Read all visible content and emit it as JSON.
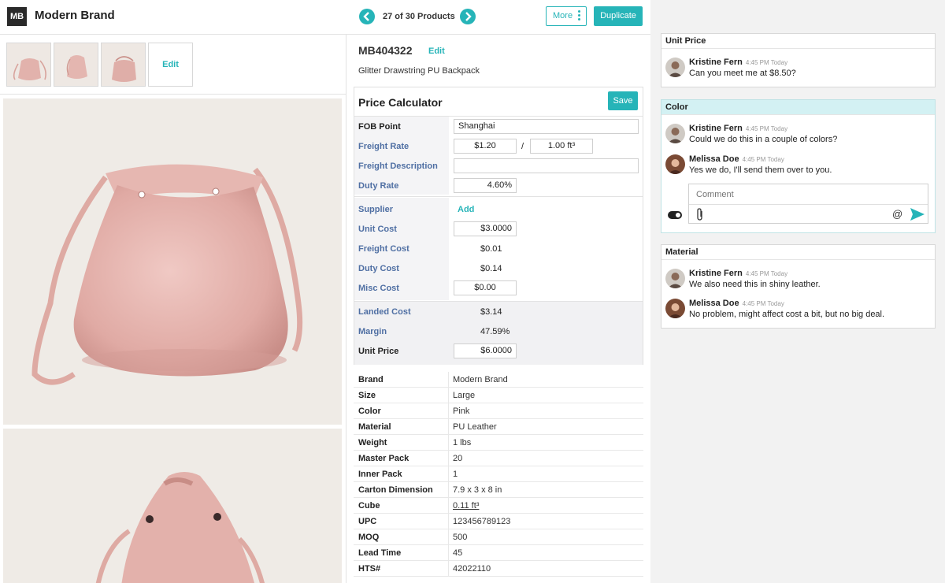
{
  "header": {
    "logo_initials": "MB",
    "brand": "Modern Brand",
    "product_counter": "27 of 30 Products",
    "prev_icon": "chevron-left-icon",
    "next_icon": "chevron-right-icon",
    "more_label": "More",
    "duplicate_label": "Duplicate",
    "accent_color": "#26b4b8"
  },
  "gallery": {
    "edit_label": "Edit",
    "thumbnail_count": 3
  },
  "product": {
    "sku": "MB404322",
    "sku_edit": "Edit",
    "name": "Glitter Drawstring PU Backpack"
  },
  "calculator": {
    "title": "Price Calculator",
    "save_label": "Save",
    "fob_point": {
      "label": "FOB Point",
      "value": "Shanghai"
    },
    "freight_rate": {
      "label": "Freight Rate",
      "value": "$1.20",
      "separator": "/",
      "unit": "1.00 ft³"
    },
    "freight_description": {
      "label": "Freight Description",
      "value": ""
    },
    "duty_rate": {
      "label": "Duty Rate",
      "value": "4.60%"
    },
    "supplier": {
      "label": "Supplier",
      "action": "Add"
    },
    "unit_cost": {
      "label": "Unit Cost",
      "value": "$3.0000"
    },
    "freight_cost": {
      "label": "Freight Cost",
      "value": "$0.01"
    },
    "duty_cost": {
      "label": "Duty Cost",
      "value": "$0.14"
    },
    "misc_cost": {
      "label": "Misc Cost",
      "value": "$0.00"
    },
    "landed_cost": {
      "label": "Landed Cost",
      "value": "$3.14"
    },
    "margin": {
      "label": "Margin",
      "value": "47.59%"
    },
    "unit_price": {
      "label": "Unit Price",
      "value": "$6.0000"
    }
  },
  "specs": [
    {
      "label": "Brand",
      "value": "Modern Brand"
    },
    {
      "label": "Size",
      "value": "Large"
    },
    {
      "label": "Color",
      "value": "Pink"
    },
    {
      "label": "Material",
      "value": "PU Leather"
    },
    {
      "label": "Weight",
      "value": "1 lbs"
    },
    {
      "label": "Master Pack",
      "value": "20"
    },
    {
      "label": "Inner Pack",
      "value": "1"
    },
    {
      "label": "Carton Dimension",
      "value": "7.9 x 3 x 8 in"
    },
    {
      "label": "Cube",
      "value": "0.11 ft³"
    },
    {
      "label": "UPC",
      "value": "123456789123"
    },
    {
      "label": "MOQ",
      "value": "500"
    },
    {
      "label": "Lead Time",
      "value": "45"
    },
    {
      "label": "HTS#",
      "value": "42022110"
    }
  ],
  "comments": {
    "unit_price": {
      "title": "Unit Price",
      "messages": [
        {
          "author": "Kristine Fern",
          "time": "4:45 PM Today",
          "text": "Can you meet me at $8.50?"
        }
      ]
    },
    "color": {
      "title": "Color",
      "messages": [
        {
          "author": "Kristine Fern",
          "time": "4:45 PM Today",
          "text": "Could we do this in a couple of colors?"
        },
        {
          "author": "Melissa Doe",
          "time": "4:45 PM Today",
          "text": "Yes we do, I'll send them over to you."
        }
      ],
      "comment_placeholder": "Comment",
      "attach_icon": "paperclip-icon",
      "mention_icon": "at-icon",
      "send_icon": "send-icon"
    },
    "material": {
      "title": "Material",
      "messages": [
        {
          "author": "Kristine Fern",
          "time": "4:45 PM Today",
          "text": "We also need this in shiny leather."
        },
        {
          "author": "Melissa Doe",
          "time": "4:45 PM Today",
          "text": "No problem, might affect cost a bit, but no big deal."
        }
      ]
    }
  }
}
